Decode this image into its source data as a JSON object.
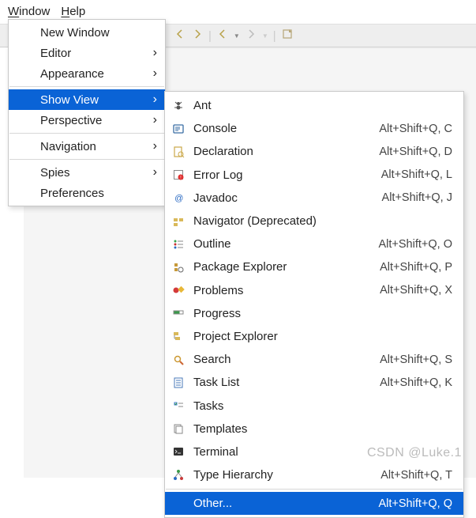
{
  "menubar": {
    "window": "Window",
    "help": "Help"
  },
  "window_menu": {
    "items": [
      {
        "label": "New Window",
        "arrow": false,
        "hl": false
      },
      {
        "label": "Editor",
        "arrow": true,
        "hl": false
      },
      {
        "label": "Appearance",
        "arrow": true,
        "hl": false
      },
      {
        "sep": true
      },
      {
        "label": "Show View",
        "arrow": true,
        "hl": true
      },
      {
        "label": "Perspective",
        "arrow": true,
        "hl": false
      },
      {
        "sep": true
      },
      {
        "label": "Navigation",
        "arrow": true,
        "hl": false
      },
      {
        "sep": true
      },
      {
        "label": "Spies",
        "arrow": true,
        "hl": false
      },
      {
        "label": "Preferences",
        "arrow": false,
        "hl": false
      }
    ]
  },
  "show_view_submenu": {
    "items": [
      {
        "icon": "ant-icon",
        "label": "Ant",
        "shortcut": ""
      },
      {
        "icon": "console-icon",
        "label": "Console",
        "shortcut": "Alt+Shift+Q, C"
      },
      {
        "icon": "declaration-icon",
        "label": "Declaration",
        "shortcut": "Alt+Shift+Q, D"
      },
      {
        "icon": "error-log-icon",
        "label": "Error Log",
        "shortcut": "Alt+Shift+Q, L"
      },
      {
        "icon": "javadoc-icon",
        "label": "Javadoc",
        "shortcut": "Alt+Shift+Q, J"
      },
      {
        "icon": "navigator-icon",
        "label": "Navigator (Deprecated)",
        "shortcut": ""
      },
      {
        "icon": "outline-icon",
        "label": "Outline",
        "shortcut": "Alt+Shift+Q, O"
      },
      {
        "icon": "package-explorer-icon",
        "label": "Package Explorer",
        "shortcut": "Alt+Shift+Q, P"
      },
      {
        "icon": "problems-icon",
        "label": "Problems",
        "shortcut": "Alt+Shift+Q, X"
      },
      {
        "icon": "progress-icon",
        "label": "Progress",
        "shortcut": ""
      },
      {
        "icon": "project-explorer-icon",
        "label": "Project Explorer",
        "shortcut": ""
      },
      {
        "icon": "search-icon",
        "label": "Search",
        "shortcut": "Alt+Shift+Q, S"
      },
      {
        "icon": "task-list-icon",
        "label": "Task List",
        "shortcut": "Alt+Shift+Q, K"
      },
      {
        "icon": "tasks-icon",
        "label": "Tasks",
        "shortcut": ""
      },
      {
        "icon": "templates-icon",
        "label": "Templates",
        "shortcut": ""
      },
      {
        "icon": "terminal-icon",
        "label": "Terminal",
        "shortcut": ""
      },
      {
        "icon": "type-hierarchy-icon",
        "label": "Type Hierarchy",
        "shortcut": "Alt+Shift+Q, T"
      }
    ],
    "other": {
      "label": "Other...",
      "shortcut": "Alt+Shift+Q, Q"
    }
  },
  "watermark": "CSDN @Luke.1"
}
